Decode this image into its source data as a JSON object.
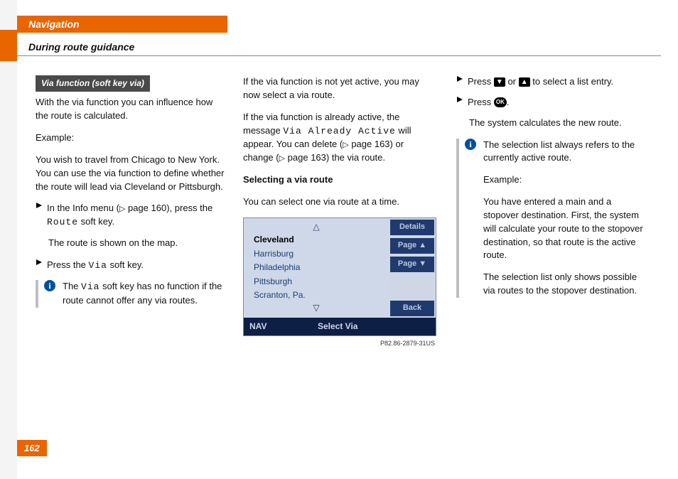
{
  "header": {
    "chapter": "Navigation",
    "section": "During route guidance",
    "page_number": "162"
  },
  "col1": {
    "subhead": "Via function (soft key via)",
    "p1": "With the via function you can influence how the route is calculated.",
    "p2": "Example:",
    "p3": "You wish to travel from Chicago to New York. You can use the via function to define whether the route will lead via Cleveland or Pittsburgh.",
    "step1a": "In the Info menu (",
    "step1b": " page 160), press the ",
    "step1c": " soft key.",
    "route_key": "Route",
    "step1_after": "The route is shown on the map.",
    "step2a": "Press the ",
    "step2b": " soft key.",
    "via_key": "Via",
    "info1a": "The ",
    "info1b": " soft key has no function if the route cannot offer any via routes."
  },
  "col2": {
    "p1": "If the via function is not yet active, you may now select a via route.",
    "p2a": "If the via function is already active, the message ",
    "p2msg": "Via Already Active",
    "p2b": " will appear. You can delete (",
    "p2c": " page 163) or change (",
    "p2d": " page 163) the via route.",
    "h2": "Selecting a via route",
    "p3": "You can select one via route at a time.",
    "device": {
      "items": [
        "Cleveland",
        "Harrisburg",
        "Philadelphia",
        "Pittsburgh",
        "Scranton, Pa."
      ],
      "side": [
        "Details",
        "Page ▲",
        "Page ▼",
        "Back"
      ],
      "foot_left": "NAV",
      "foot_center": "Select Via",
      "caption": "P82.86-2879-31US"
    }
  },
  "col3": {
    "step1a": "Press ",
    "step1b": " or ",
    "step1c": " to select a list entry.",
    "step2a": "Press ",
    "step2b": ".",
    "after2": "The system calculates the new route.",
    "info_p1": "The selection list always refers to the currently active route.",
    "info_p2": "Example:",
    "info_p3": "You have entered a main and a stopover destination. First, the system will calculate your route to the stopover destination, so that route is the active route.",
    "info_p4": "The selection list only shows possible via routes to the stopover destination."
  }
}
